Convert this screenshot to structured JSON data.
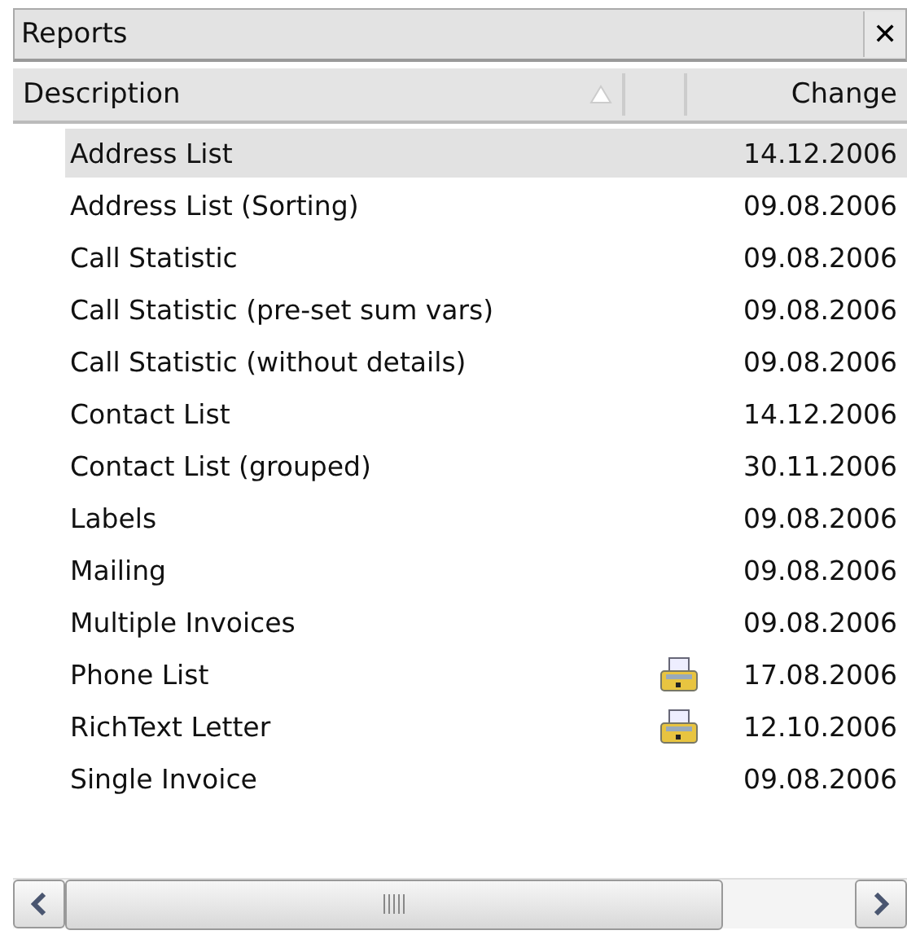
{
  "panel": {
    "title": "Reports",
    "close": "✕"
  },
  "table": {
    "columns": [
      {
        "label": "Description",
        "sorted": true
      },
      {
        "label": "Change",
        "sorted": false
      }
    ],
    "rows": [
      {
        "description": "Address List",
        "change": "14.12.2006",
        "selected": true,
        "printer": false
      },
      {
        "description": "Address List (Sorting)",
        "change": "09.08.2006",
        "selected": false,
        "printer": false
      },
      {
        "description": "Call Statistic",
        "change": "09.08.2006",
        "selected": false,
        "printer": false
      },
      {
        "description": "Call Statistic (pre-set sum vars)",
        "change": "09.08.2006",
        "selected": false,
        "printer": false
      },
      {
        "description": "Call Statistic (without details)",
        "change": "09.08.2006",
        "selected": false,
        "printer": false
      },
      {
        "description": "Contact List",
        "change": "14.12.2006",
        "selected": false,
        "printer": false
      },
      {
        "description": "Contact List (grouped)",
        "change": "30.11.2006",
        "selected": false,
        "printer": false
      },
      {
        "description": "Labels",
        "change": "09.08.2006",
        "selected": false,
        "printer": false
      },
      {
        "description": "Mailing",
        "change": "09.08.2006",
        "selected": false,
        "printer": false
      },
      {
        "description": "Multiple Invoices",
        "change": "09.08.2006",
        "selected": false,
        "printer": false
      },
      {
        "description": "Phone List",
        "change": "17.08.2006",
        "selected": false,
        "printer": true
      },
      {
        "description": "RichText Letter",
        "change": "12.10.2006",
        "selected": false,
        "printer": true
      },
      {
        "description": "Single Invoice",
        "change": "09.08.2006",
        "selected": false,
        "printer": false
      }
    ]
  }
}
